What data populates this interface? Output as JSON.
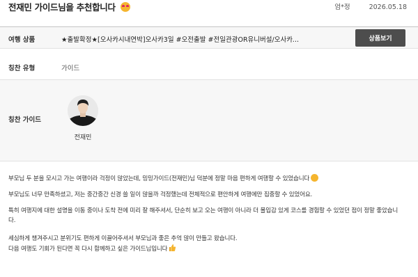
{
  "header": {
    "title": "전재민 가이드님을 추천합니다",
    "title_emoji": "heart-eyes-emoji",
    "author": "엄*정",
    "date": "2026.05.18"
  },
  "product": {
    "label": "여행 상품",
    "name": "★출발확정★[오사카시내연박]오사카3일 #오전출발 #전일관광OR유니버설/오사카...",
    "button_label": "상품보기"
  },
  "praise_type": {
    "label": "칭찬 유형",
    "value": "가이드"
  },
  "praise_guide": {
    "label": "칭찬 가이드",
    "name": "전재민"
  },
  "review": {
    "p1": "부모님 두 분을 모시고 가는 여행이라 걱정이 많았는데, 밍밍가이드(전재민)님 덕분에 정말 마음 편하게 여행할 수 있었습니다",
    "p2": "부모님도 너무 만족하셨고, 저는 중간중간 신경 쓸 일이 많을까 걱정했는데 전체적으로 편안하게 여행에만 집중할 수 있었어요.",
    "p3": "특히 여행지에 대한 설명을 이동 중이나 도착 전에 미리 잘 해주셔서, 단순히 보고 오는 여행이 아니라 더 몰입감 있게 코스를 경험할 수 있었던 점이 정말 좋았습니다.",
    "p4_line1": "세심하게 챙겨주시고 분위기도 편하게 이끌어주셔서 부모님과 좋은 추억 많이 만들고 왔습니다.",
    "p4_line2": "다음 여행도 기회가 된다면 꼭 다시 함께하고 싶은 가이드님입니다",
    "emoji_1": "smile-emoji",
    "emoji_2": "thumbs-up-emoji"
  }
}
